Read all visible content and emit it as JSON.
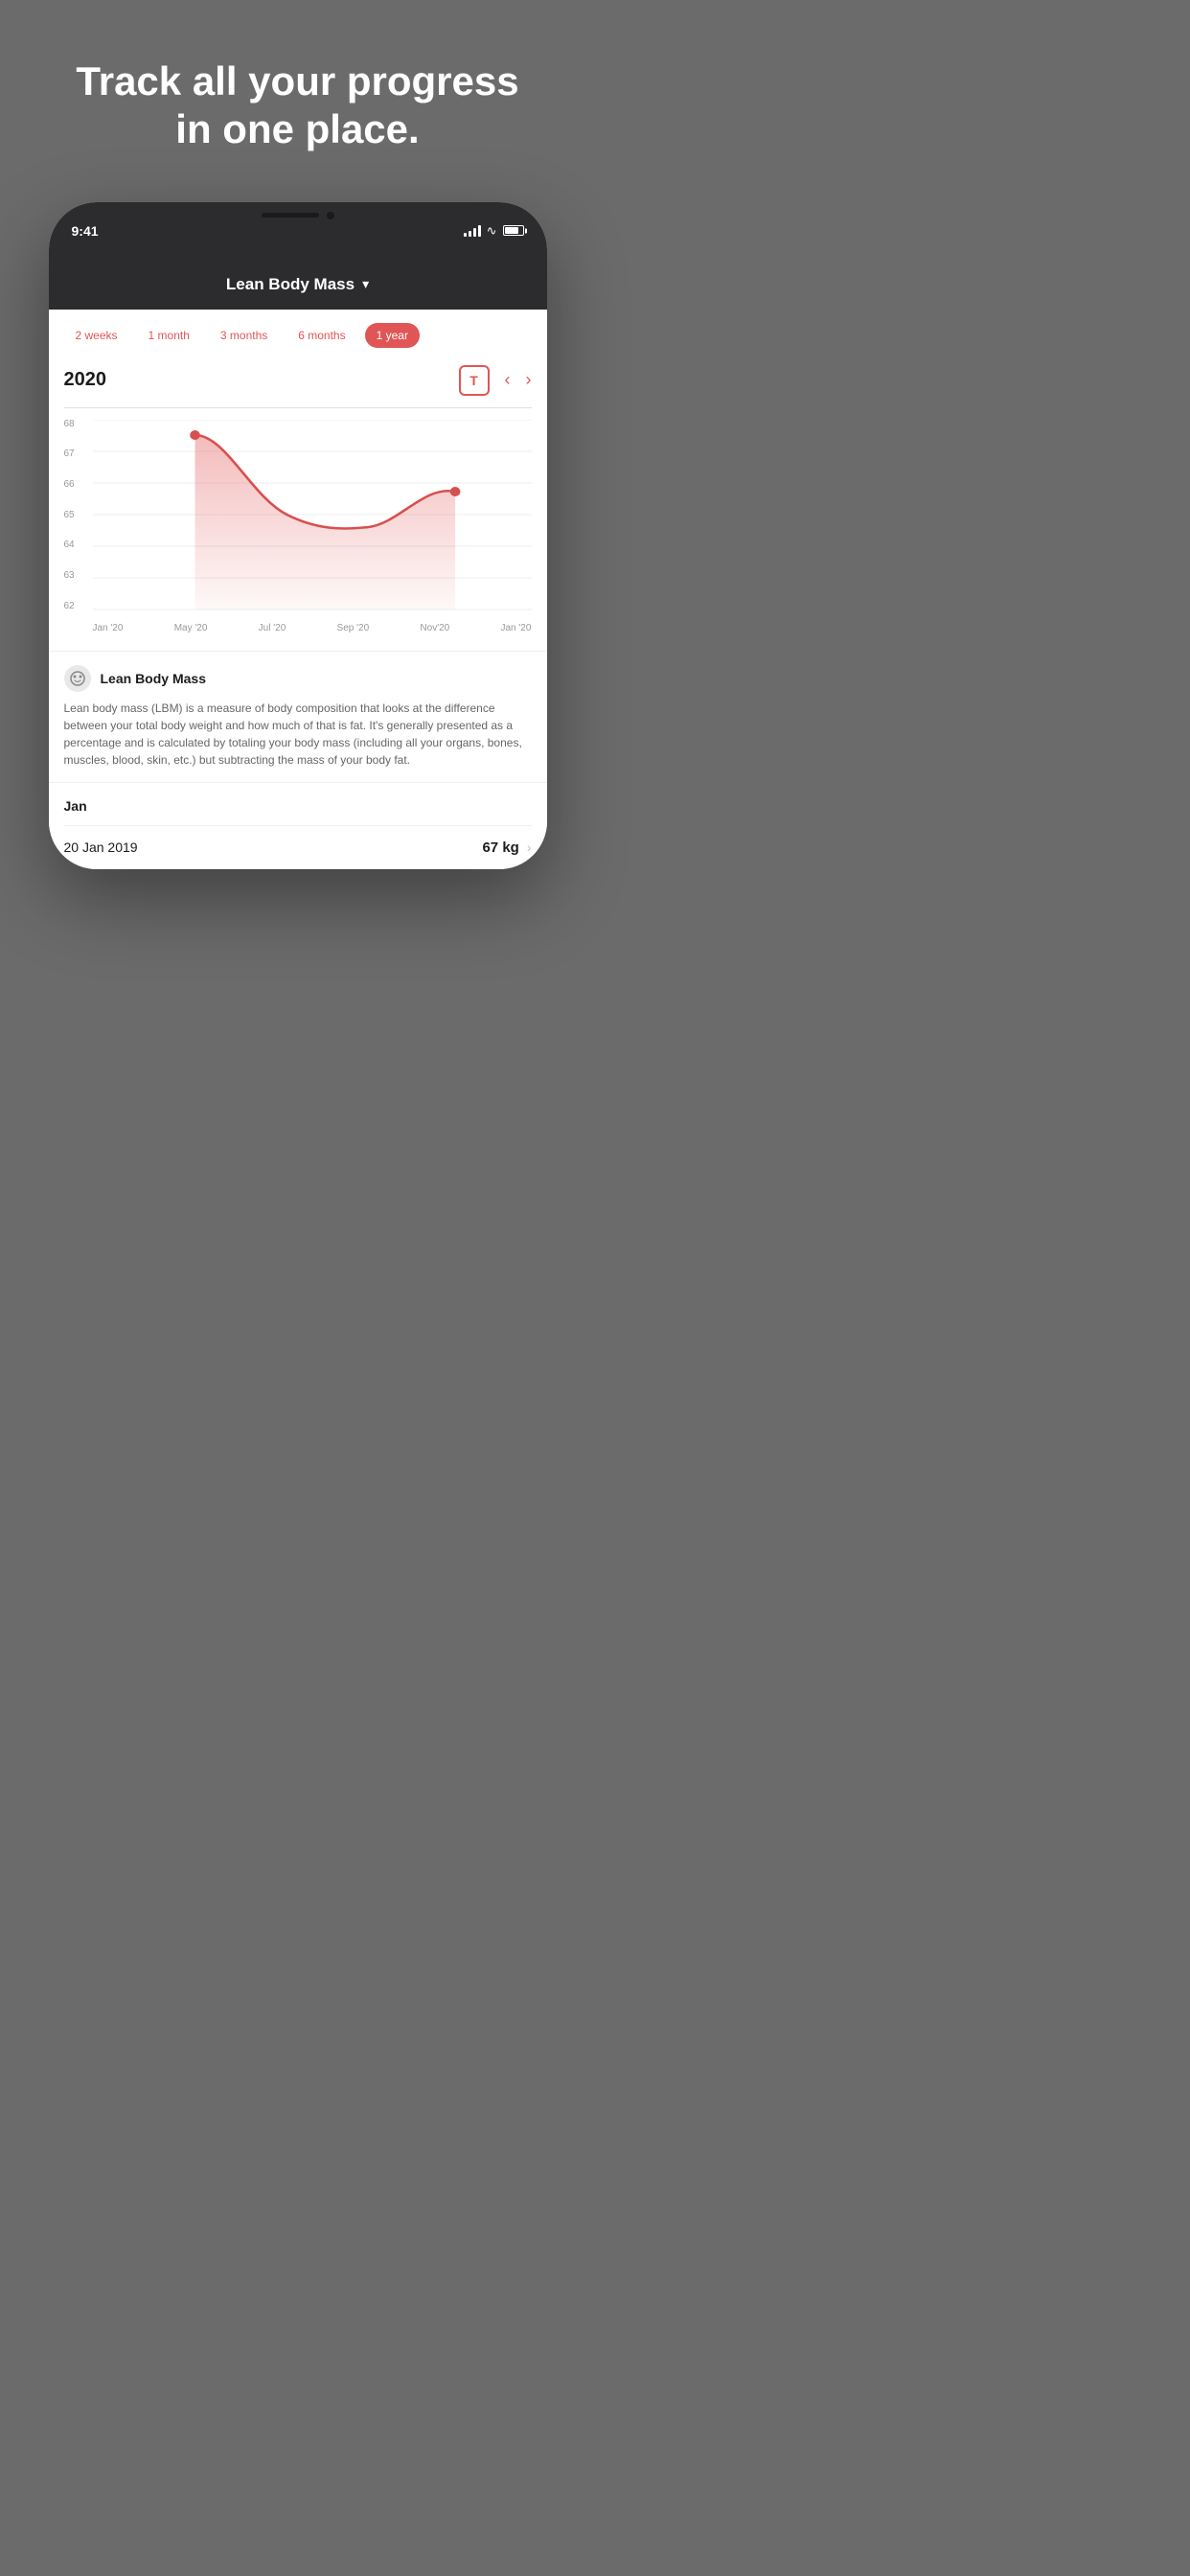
{
  "hero": {
    "title": "Track all your progress in one place."
  },
  "phone": {
    "status": {
      "time": "9:41",
      "signal": true,
      "wifi": true,
      "battery": true
    },
    "nav": {
      "title": "Lean Body Mass",
      "chevron": "▾"
    },
    "filters": [
      {
        "label": "2 weeks",
        "active": false
      },
      {
        "label": "1 month",
        "active": false
      },
      {
        "label": "3 months",
        "active": false
      },
      {
        "label": "6 months",
        "active": false
      },
      {
        "label": "1 year",
        "active": true
      }
    ],
    "chart": {
      "year": "2020",
      "t_button": "T",
      "y_labels": [
        "68",
        "67",
        "66",
        "65",
        "64",
        "63",
        "62"
      ],
      "x_labels": [
        "Jan '20",
        "May '20",
        "Jul '20",
        "Sep '20",
        "Nov'20",
        "Jan '20"
      ]
    },
    "info": {
      "icon": "⊛",
      "title": "Lean Body Mass",
      "body": "Lean body mass (LBM) is a measure of body composition that looks at the difference between your total body weight and how much of that is fat. It's generally presented as a percentage and is calculated by totaling your body mass (including all your organs, bones, muscles, blood, skin, etc.) but subtracting the mass of your body fat."
    },
    "data_list": {
      "month": "Jan",
      "items": [
        {
          "date": "20 Jan 2019",
          "value": "67 kg",
          "has_chevron": true
        }
      ]
    }
  }
}
